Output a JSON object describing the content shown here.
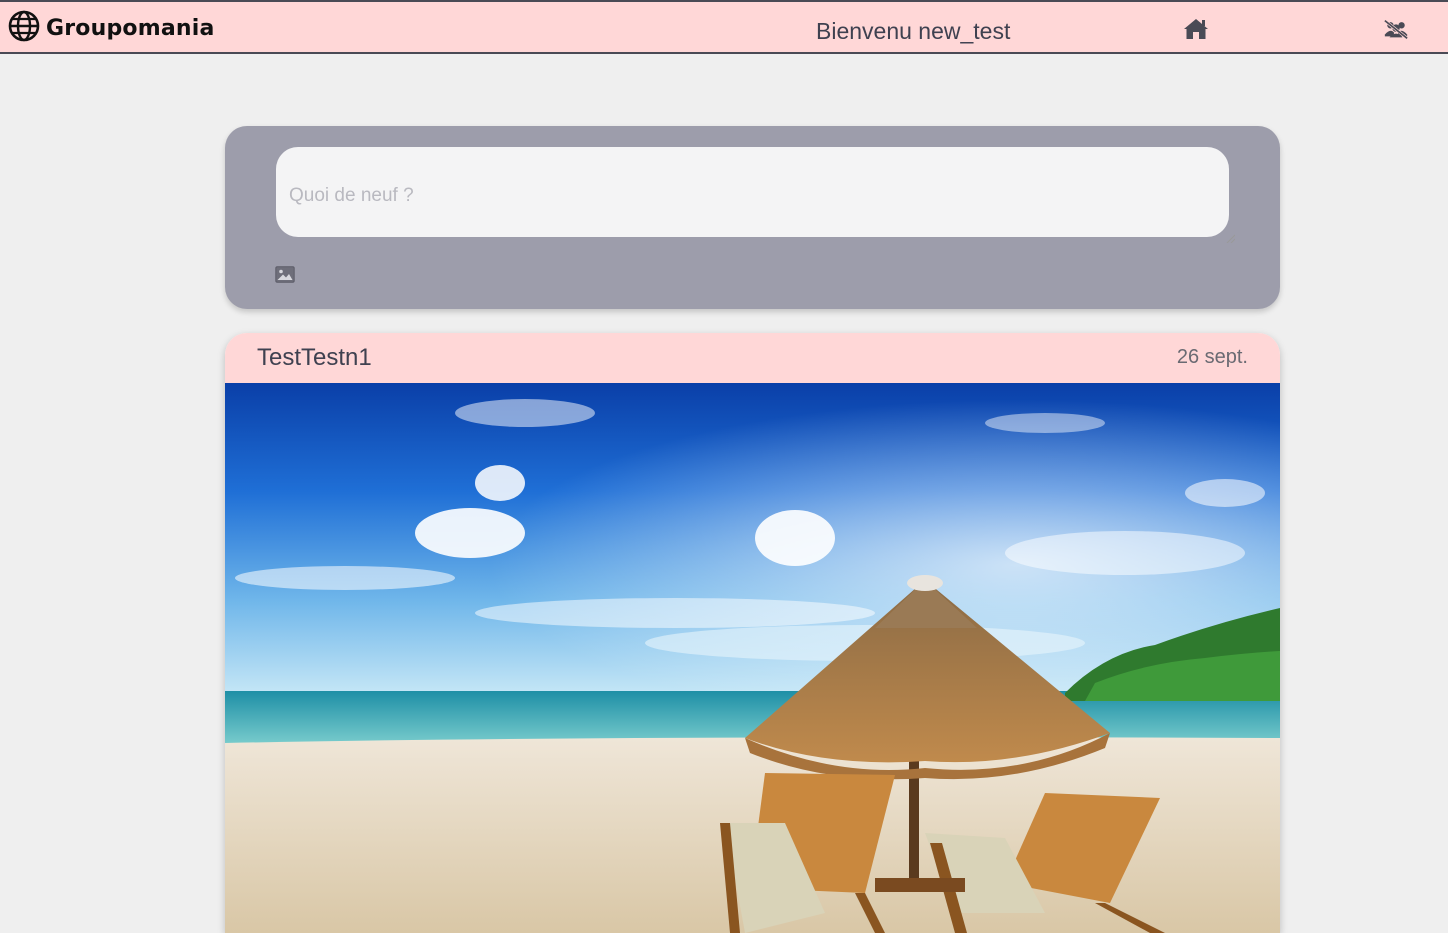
{
  "header": {
    "brand": "Groupomania",
    "welcome": "Bienvenu new_test",
    "icons": {
      "logo": "globe-icon",
      "home": "home-icon",
      "users": "users-slash-icon"
    }
  },
  "composer": {
    "placeholder": "Quoi de neuf ?",
    "image_icon": "image-icon"
  },
  "posts": [
    {
      "author": "TestTestn1",
      "date": "26 sept.",
      "image": "beach-with-straw-umbrella-and-two-lounge-chairs"
    }
  ],
  "colors": {
    "header_bg": "#ffd7d7",
    "page_bg": "#efefef",
    "composer_bg": "#9d9dab",
    "accent_text": "#3f4150"
  }
}
